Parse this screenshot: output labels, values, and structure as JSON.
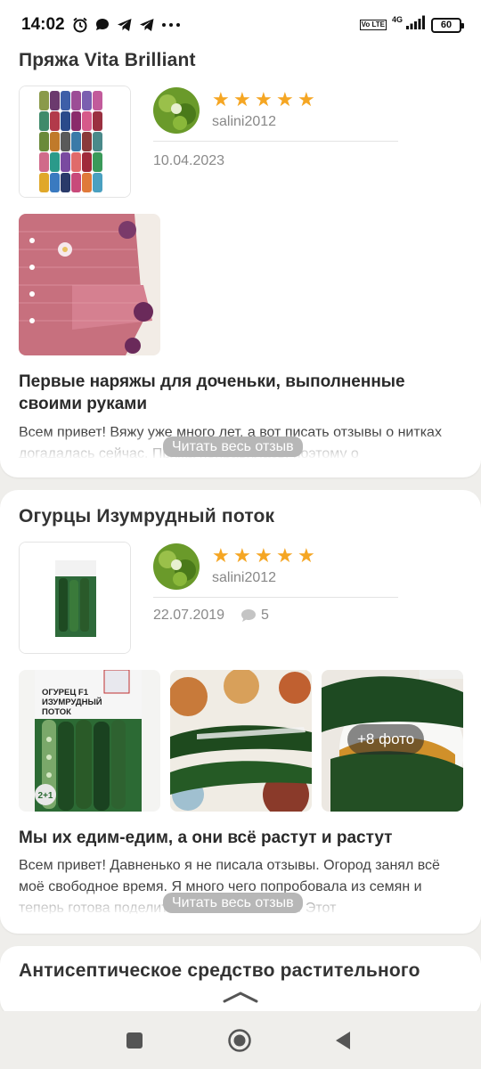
{
  "status_bar": {
    "time": "14:02",
    "network": "4G",
    "volte": "Vo LTE",
    "battery": "60"
  },
  "reviews": [
    {
      "product_title": "Пряжа Vita Brilliant",
      "username": "salini2012",
      "rating": 5,
      "date": "10.04.2023",
      "review_title": "Первые наряжы для доченьки, выполненные своими руками",
      "review_text": "Всем привет! Вяжу уже много лет, а вот писать отзывы о нитках догадалась сейчас. Пряжа понравилась, поэтому о",
      "read_more": "Читать весь отзыв"
    },
    {
      "product_title": "Огурцы Изумрудный поток",
      "username": "salini2012",
      "rating": 5,
      "date": "22.07.2019",
      "comments": "5",
      "more_photos": "+8 фото",
      "package_text": "ОГУРЕЦ F1 ИЗУМРУДНЫЙ ПОТОК",
      "review_title": "Мы их едим-едим, а они всё растут и растут",
      "review_text": "Всем привет! Давненько я не писала отзывы. Огород занял всё моё свободное время. Я много чего попробовала из семян и теперь готова поделиться своим мнением. Этот",
      "read_more": "Читать весь отзыв"
    },
    {
      "product_title": "Антисептическое средство растительного"
    }
  ],
  "colors": {
    "star": "#f5a623",
    "background": "#efeeeb",
    "read_more_bg": "#b7b7b7"
  }
}
